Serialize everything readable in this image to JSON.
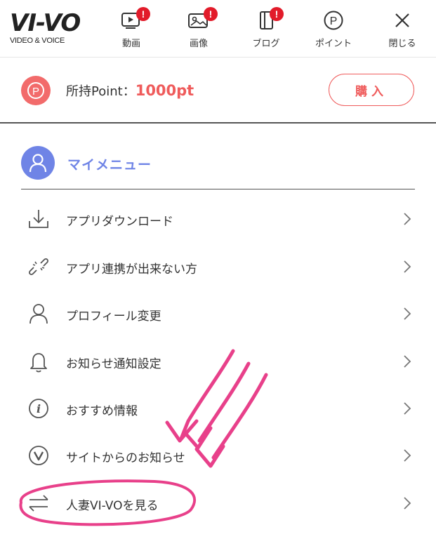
{
  "brand": {
    "logo_text": "VI-VO",
    "tagline": "VIDEO & VOICE"
  },
  "nav": [
    {
      "label": "動画",
      "icon": "video-icon",
      "badge": "!"
    },
    {
      "label": "画像",
      "icon": "image-icon",
      "badge": "!"
    },
    {
      "label": "ブログ",
      "icon": "blog-icon",
      "badge": "!"
    },
    {
      "label": "ポイント",
      "icon": "point-icon",
      "badge": ""
    },
    {
      "label": "閉じる",
      "icon": "close-icon",
      "badge": ""
    }
  ],
  "points": {
    "label": "所持Point：",
    "value": "1000pt",
    "buy_label": "購入"
  },
  "my_menu": {
    "title": "マイメニュー",
    "items": [
      {
        "label": "アプリダウンロード",
        "icon": "download-icon"
      },
      {
        "label": "アプリ連携が出来ない方",
        "icon": "broken-link-icon"
      },
      {
        "label": "プロフィール変更",
        "icon": "user-icon"
      },
      {
        "label": "お知らせ通知設定",
        "icon": "bell-icon"
      },
      {
        "label": "おすすめ情報",
        "icon": "info-icon"
      },
      {
        "label": "サイトからのお知らせ",
        "icon": "v-circle-icon"
      },
      {
        "label": "人妻VI-VOを見る",
        "icon": "swap-arrows-icon"
      }
    ]
  },
  "colors": {
    "accent_red": "#ef5b5b",
    "accent_blue": "#6f84e6",
    "annotation_pink": "#e8408a",
    "badge_red": "#e21b2a"
  }
}
